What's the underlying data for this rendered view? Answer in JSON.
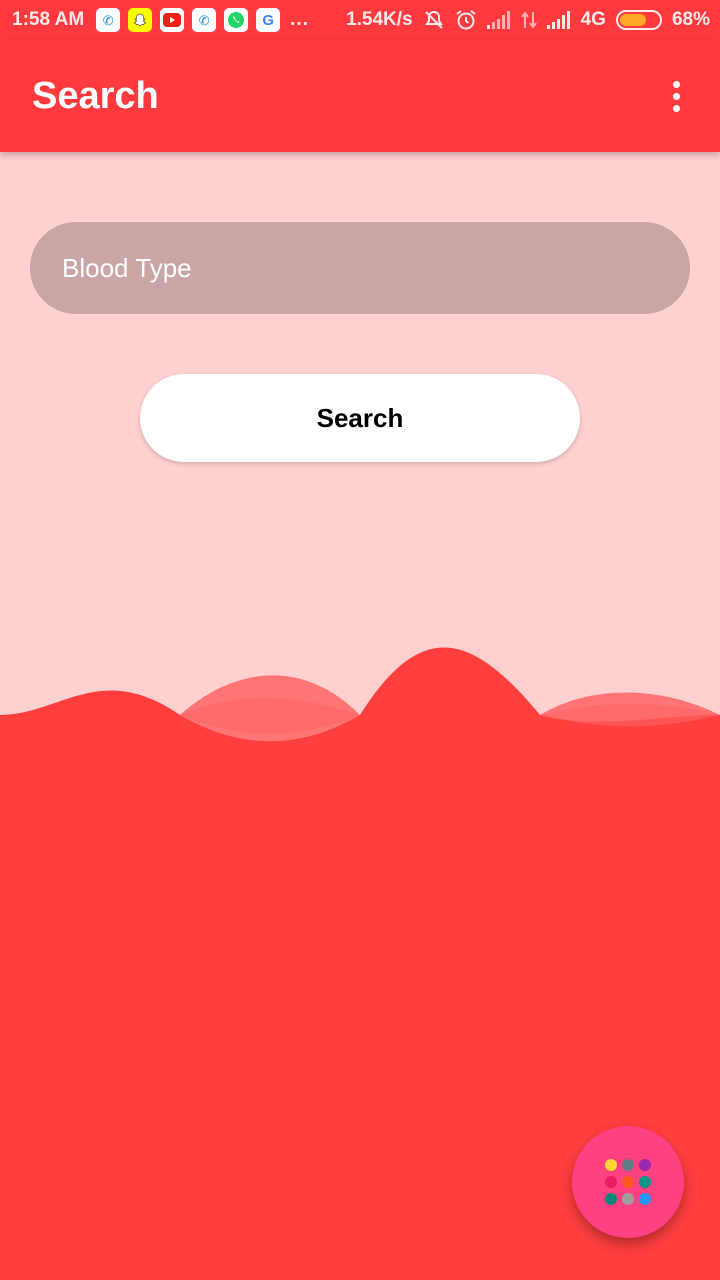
{
  "status_bar": {
    "time": "1:58 AM",
    "more": "...",
    "network_speed": "1.54K/s",
    "network_type": "4G",
    "battery_percent": "68%",
    "battery_level": 0.68,
    "notification_icons": [
      "phone-icon",
      "snapchat-icon",
      "youtube-icon",
      "phone-icon",
      "whatsapp-icon",
      "google-icon"
    ]
  },
  "app_bar": {
    "title": "Search"
  },
  "form": {
    "blood_type_placeholder": "Blood Type",
    "blood_type_value": "",
    "search_label": "Search"
  },
  "colors": {
    "primary": "#ff3a3f",
    "background": "#ffd0d0",
    "input_background": "#caa5a5",
    "fab": "#ff4081"
  },
  "fab": {
    "icon": "apps-grid-icon",
    "dot_colors": [
      "#fdd835",
      "#607d8b",
      "#9c27b0",
      "#e91e63",
      "#ff5722",
      "#009688",
      "#00897b",
      "#9e9e9e",
      "#2196f3"
    ]
  }
}
